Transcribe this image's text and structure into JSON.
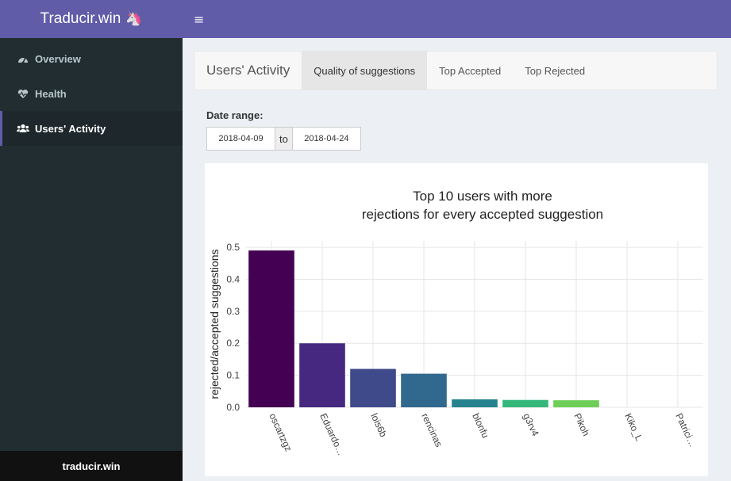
{
  "app": {
    "brand": "Traducir.win",
    "footer": "traducir.win"
  },
  "sidebar": {
    "items": [
      {
        "label": "Overview",
        "icon": "dashboard-icon",
        "glyph": "◔"
      },
      {
        "label": "Health",
        "icon": "heartbeat-icon",
        "glyph": "♡"
      },
      {
        "label": "Users' Activity",
        "icon": "users-icon",
        "glyph": "●"
      }
    ]
  },
  "tabs": {
    "title": "Users' Activity",
    "items": [
      "Quality of suggestions",
      "Top Accepted",
      "Top Rejected"
    ]
  },
  "filters": {
    "label": "Date range:",
    "start": "2018-04-09",
    "separator": "to",
    "end": "2018-04-24"
  },
  "chart_data": {
    "type": "bar",
    "title_lines": [
      "Top 10 users with more",
      "rejections for every accepted suggestion"
    ],
    "xlabel": "",
    "ylabel": "rejected/accepted suggestions",
    "categories": [
      "oscartzgz",
      "Eduardo…",
      "lois6b",
      "rencinas",
      "blonfu",
      "g3rv4",
      "Pikoh",
      "Kiko_L",
      "Patrici…"
    ],
    "values": [
      0.49,
      0.2,
      0.12,
      0.105,
      0.025,
      0.023,
      0.022,
      0,
      0
    ],
    "colors": [
      "#440154",
      "#472880",
      "#3e4a89",
      "#31688e",
      "#26828e",
      "#35b779",
      "#6ece58",
      "#b5de2b",
      "#fde725"
    ],
    "yticks": [
      0.0,
      0.1,
      0.2,
      0.3,
      0.4,
      0.5
    ],
    "ytick_labels": [
      "0.0",
      "0.1",
      "0.2",
      "0.3",
      "0.4",
      "0.5"
    ],
    "ylim": [
      0,
      0.52
    ],
    "grid": true
  }
}
